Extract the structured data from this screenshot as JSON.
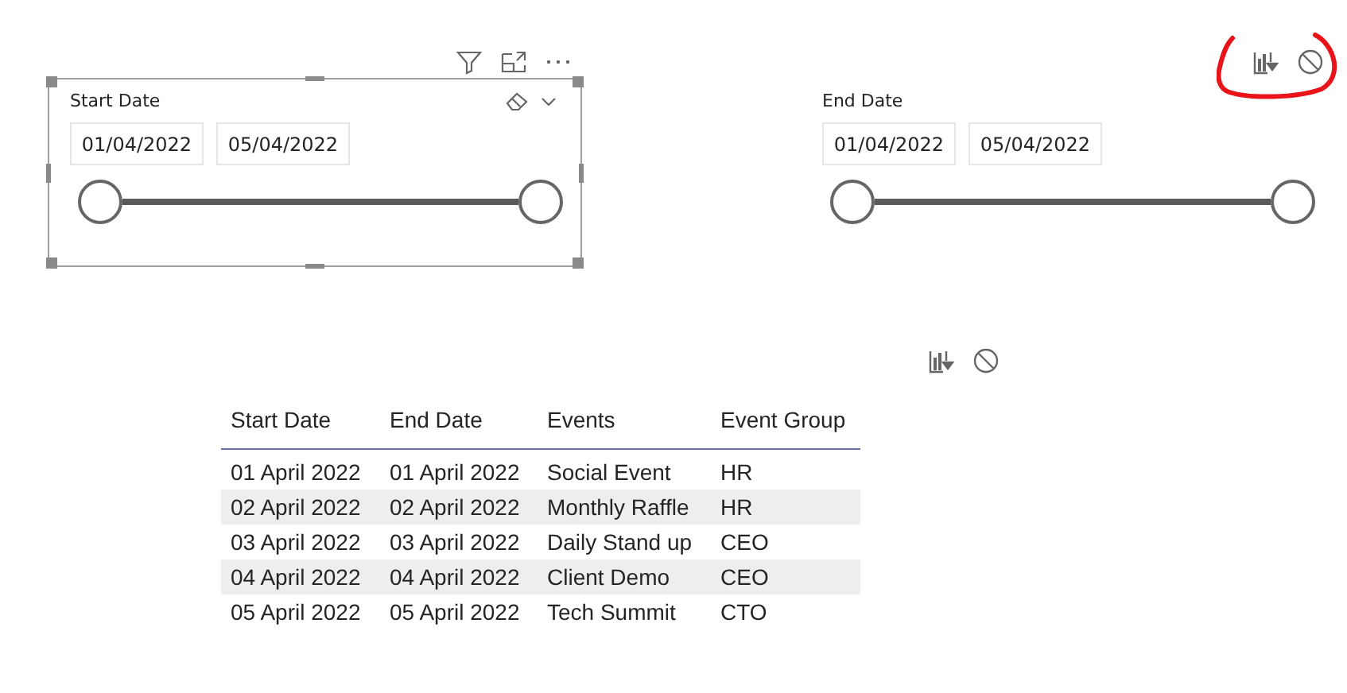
{
  "slicers": [
    {
      "title": "Start Date",
      "selected": true,
      "header_icons": [
        {
          "kind": "filter"
        },
        {
          "kind": "focus"
        },
        {
          "kind": "more"
        }
      ],
      "inputs": [
        "01/04/2022",
        "05/04/2022"
      ]
    },
    {
      "title": "End Date",
      "selected": false,
      "header_icons": [
        {
          "kind": "visual-filter"
        },
        {
          "kind": "no-filter"
        }
      ],
      "inputs": [
        "01/04/2022",
        "05/04/2022"
      ]
    }
  ],
  "table": {
    "header_icons": [
      {
        "kind": "visual-filter"
      },
      {
        "kind": "no-filter"
      }
    ],
    "columns": [
      "Start Date",
      "End Date",
      "Events",
      "Event Group"
    ],
    "rows": [
      [
        "01 April 2022",
        "01 April 2022",
        "Social Event",
        "HR"
      ],
      [
        "02 April 2022",
        "02 April 2022",
        "Monthly Raffle",
        "HR"
      ],
      [
        "03 April 2022",
        "03 April 2022",
        "Daily Stand up",
        "CEO"
      ],
      [
        "04 April 2022",
        "04 April 2022",
        "Client Demo",
        "CEO"
      ],
      [
        "05 April 2022",
        "05 April 2022",
        "Tech Summit",
        "CTO"
      ]
    ]
  }
}
